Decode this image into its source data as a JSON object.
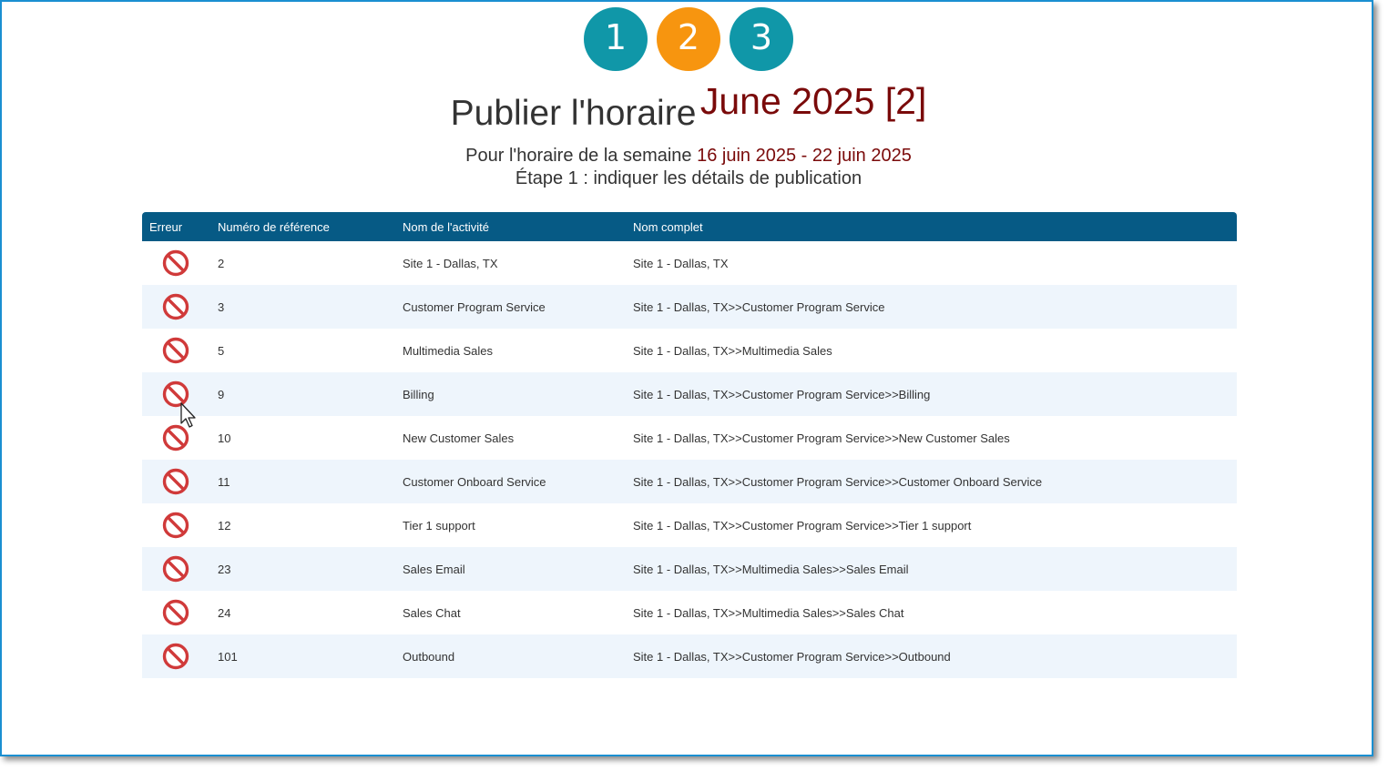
{
  "steps": [
    {
      "label": "1",
      "color": "#1097a8"
    },
    {
      "label": "2",
      "color": "#f7950f"
    },
    {
      "label": "3",
      "color": "#1097a8"
    }
  ],
  "header": {
    "title": "Publier l'horaire",
    "period": "June 2025 [2]",
    "week_prefix": "Pour l'horaire de la semaine",
    "week_range": "16 juin 2025 - 22 juin 2025",
    "step_text": "Étape 1 : indiquer les détails de publication"
  },
  "table": {
    "columns": [
      "Erreur",
      "Numéro de référence",
      "Nom de l'activité",
      "Nom complet"
    ],
    "rows": [
      {
        "ref": "2",
        "activity": "Site 1 - Dallas, TX",
        "full": "Site 1 - Dallas, TX"
      },
      {
        "ref": "3",
        "activity": "Customer Program Service",
        "full": "Site 1 - Dallas, TX>>Customer Program Service"
      },
      {
        "ref": "5",
        "activity": "Multimedia Sales",
        "full": "Site 1 - Dallas, TX>>Multimedia Sales"
      },
      {
        "ref": "9",
        "activity": "Billing",
        "full": "Site 1 - Dallas, TX>>Customer Program Service>>Billing"
      },
      {
        "ref": "10",
        "activity": "New Customer Sales",
        "full": "Site 1 - Dallas, TX>>Customer Program Service>>New Customer Sales"
      },
      {
        "ref": "11",
        "activity": "Customer Onboard Service",
        "full": "Site 1 - Dallas, TX>>Customer Program Service>>Customer Onboard Service"
      },
      {
        "ref": "12",
        "activity": "Tier 1 support",
        "full": "Site 1 - Dallas, TX>>Customer Program Service>>Tier 1 support"
      },
      {
        "ref": "23",
        "activity": "Sales Email",
        "full": "Site 1 - Dallas, TX>>Multimedia Sales>>Sales Email"
      },
      {
        "ref": "24",
        "activity": "Sales Chat",
        "full": "Site 1 - Dallas, TX>>Multimedia Sales>>Sales Chat"
      },
      {
        "ref": "101",
        "activity": "Outbound",
        "full": "Site 1 - Dallas, TX>>Customer Program Service>>Outbound"
      }
    ],
    "error_icon": "prohibited-icon",
    "error_color": "#d03a3a"
  }
}
